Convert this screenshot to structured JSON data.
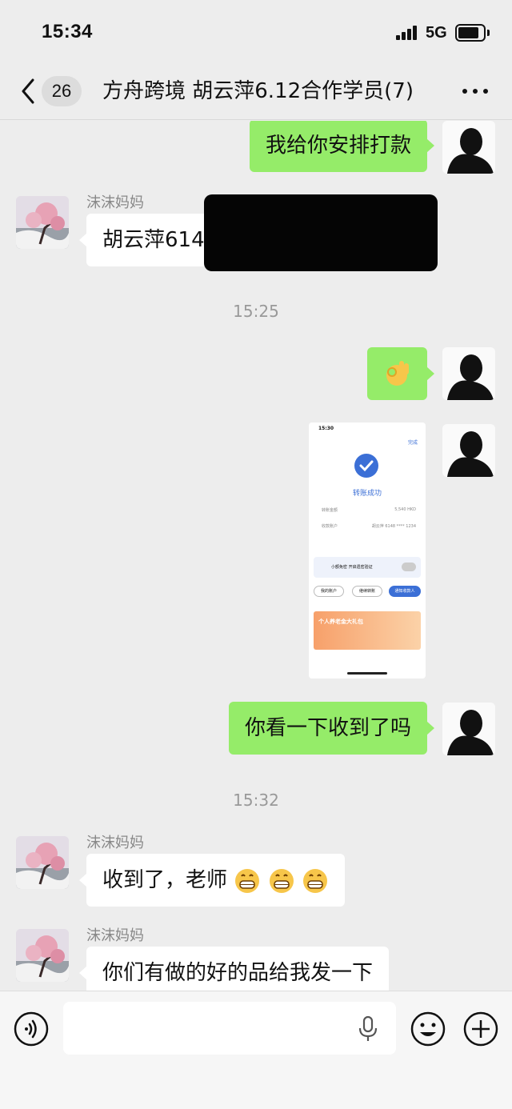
{
  "status": {
    "time": "15:34",
    "network": "5G"
  },
  "nav": {
    "badge": "26",
    "title": "方舟跨境 胡云萍6.12合作学员(7)",
    "icons": {
      "back": "chevron-left-icon",
      "more": "more-dots-icon"
    }
  },
  "messages": {
    "m1": {
      "text": "我给你安排打款"
    },
    "m2": {
      "sender": "沫沫妈妈",
      "text": "胡云萍614"
    },
    "ts1": "15:25",
    "m3": {
      "emoji": "ok-hand-emoji"
    },
    "m4": {
      "image": {
        "time": "15:30",
        "done": "完成",
        "status": "转账成功",
        "rows": [
          {
            "label": "转账金额",
            "value": "5,540 HKD"
          },
          {
            "label": "收款账户",
            "value": "胡云萍 6148 **** 1234"
          }
        ],
        "toggle": "小额免密 开启遗密验证",
        "buttons": [
          "我的账户",
          "继续转账",
          "通知收款人"
        ],
        "banner": "个人养老金大礼包"
      }
    },
    "m5": {
      "text": "你看一下收到了吗"
    },
    "ts2": "15:32",
    "m6": {
      "sender": "沫沫妈妈",
      "text": "收到了，老师"
    },
    "m7": {
      "sender": "沫沫妈妈",
      "text": "你们有做的好的品给我发一下"
    }
  },
  "input": {
    "placeholder": "",
    "icons": {
      "voice": "voice-icon",
      "mic": "microphone-icon",
      "emoji": "emoji-icon",
      "plus": "plus-icon"
    }
  },
  "colors": {
    "outgoing": "#95ec69",
    "incoming": "#ffffff",
    "background": "#ededed",
    "accent": "#3b6fd6"
  }
}
